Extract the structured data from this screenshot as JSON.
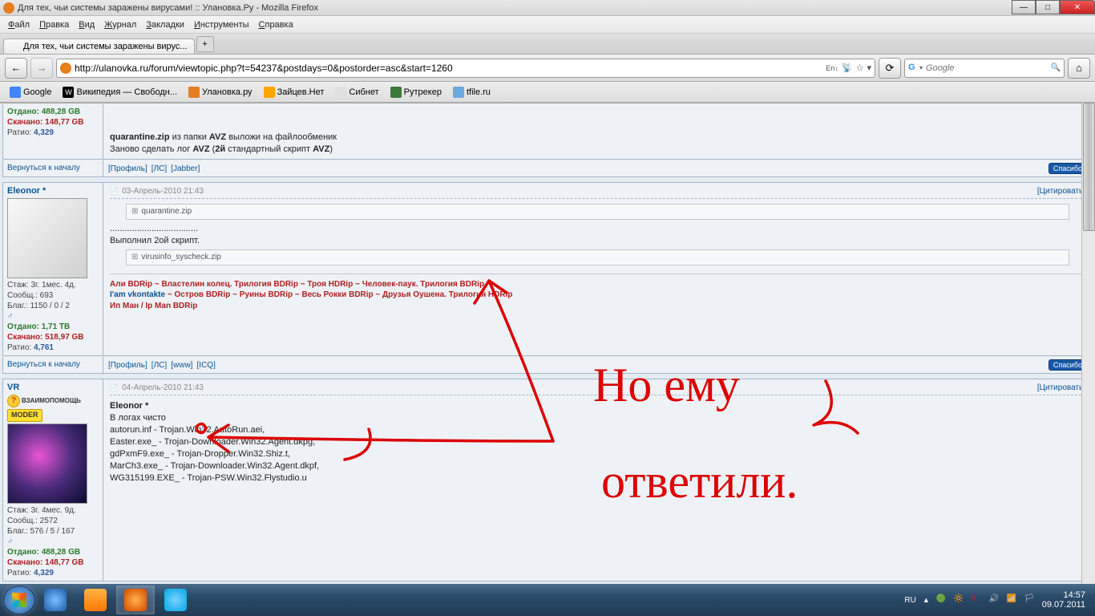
{
  "window": {
    "title": "Для тех, чьи системы заражены вирусами! :: Улановка.Ру - Mozilla Firefox"
  },
  "menu": [
    "Файл",
    "Правка",
    "Вид",
    "Журнал",
    "Закладки",
    "Инструменты",
    "Справка"
  ],
  "tab": {
    "title": "Для тех, чьи системы заражены вирус..."
  },
  "url": "http://ulanovka.ru/forum/viewtopic.php?t=54237&postdays=0&postorder=asc&start=1260",
  "search_placeholder": "Google",
  "bookmarks": [
    "Google",
    "Википедия — Свободн...",
    "Улановка.ру",
    "Зайцев.Нет",
    "Сибнет",
    "Рутрекер",
    "tfile.ru"
  ],
  "post0": {
    "stats": {
      "otd": "Отдано: 488,28 GB",
      "ska": "Скачано: 148,77 GB",
      "rat": "Ратио: 4,329"
    },
    "body_l1": "quarantine.zip из папки AVZ выложи на файлообменик",
    "body_l2": "Заново сделать лог AVZ (2й стандартный скрипт AVZ)",
    "back": "Вернуться к началу",
    "flinks": [
      "Профиль",
      "ЛС",
      "Jabber"
    ],
    "thx": "Спасибо"
  },
  "post1": {
    "user": "Eleonor *",
    "date": "03-Апрель-2010 21:43",
    "quote": "Цитировать",
    "stats": {
      "l1": "Стаж: 3г. 1мес. 4д.",
      "l2": "Сообщ.: 693",
      "l3": "Благ.: 1150 / 0 / 2",
      "otd": "Отдано: 1,71 TB",
      "ska": "Скачано: 518,97 GB",
      "rat": "Ратио: 4,761"
    },
    "att1": "quarantine.zip",
    "dots": "....................................",
    "txt": "Выполнил 2ой скрипт.",
    "att2": "virusinfo_syscheck.zip",
    "sig_l1": "Али BDRip ~ Властелин колец. Трилогия BDRip ~ Троя HDRip ~ Человек-паук. Трилогия BDRip",
    "sig_l2a": "I'am vkontakte",
    "sig_l2b": " ~ Остров BDRip ~ Руины BDRip ~ Весь Рокки BDRip ~ Друзья Оушена. Трилогия HDRip",
    "sig_l3": "Ип Ман / Ip Man BDRip",
    "back": "Вернуться к началу",
    "flinks": [
      "Профиль",
      "ЛС",
      "www",
      "ICQ"
    ],
    "thx": "Спасибо"
  },
  "post2": {
    "user": "VR",
    "date": "04-Апрель-2010 21:43",
    "quote": "Цитировать",
    "badge_help": "ВЗАИМОПОМОЩЬ",
    "badge_moder": "MODER",
    "stats": {
      "l1": "Стаж: 3г. 4мес. 9д.",
      "l2": "Сообщ.: 2572",
      "l3": "Благ.: 576 / 5 / 167",
      "otd": "Отдано: 488,28 GB",
      "ska": "Скачано: 148,77 GB",
      "rat": "Ратио: 4,329"
    },
    "body": {
      "l0": "Eleonor *",
      "l1": "В логах чисто",
      "l2": "autorun.inf - Trojan.Win32.AutoRun.aei,",
      "l3": "Easter.exe_ - Trojan-Downloader.Win32.Agent.dkpg,",
      "l4": "gdPxmF9.exe_ - Trojan-Dropper.Win32.Shiz.t,",
      "l5": "MarCh3.exe_ - Trojan-Downloader.Win32.Agent.dkpf,",
      "l6": "WG315199.EXE_ - Trojan-PSW.Win32.Flystudio.u"
    }
  },
  "annot": {
    "t1": "Но ему",
    "t2": "ответили."
  },
  "tray": {
    "lang": "RU",
    "time": "14:57",
    "date": "09.07.2011"
  }
}
